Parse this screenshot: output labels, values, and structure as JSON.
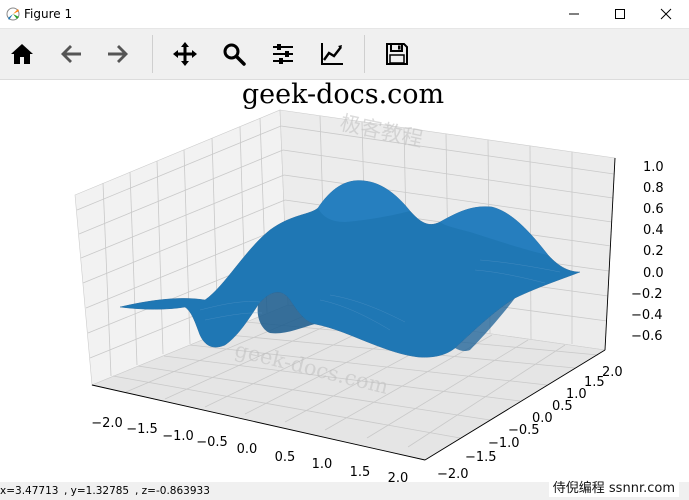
{
  "window": {
    "title": "Figure 1"
  },
  "toolbar": {
    "buttons": [
      {
        "icon": "home-icon"
      },
      {
        "icon": "back-arrow-icon"
      },
      {
        "icon": "forward-arrow-icon"
      },
      {
        "icon": "pan-move-icon"
      },
      {
        "icon": "zoom-magnifier-icon"
      },
      {
        "icon": "configure-subplots-icon"
      },
      {
        "icon": "edit-axes-icon"
      },
      {
        "icon": "save-disk-icon"
      }
    ]
  },
  "figure": {
    "title": "geek-docs.com",
    "watermark_top": "极客教程",
    "watermark_mid": "geek-docs.com",
    "surface_color": "#1f77b4",
    "x_ticks": [
      "−2.0",
      "−1.5",
      "−1.0",
      "−0.5",
      "0.0",
      "0.5",
      "1.0",
      "1.5",
      "2.0"
    ],
    "y_ticks": [
      "−2.0",
      "−1.5",
      "−1.0",
      "−0.5",
      "0.0",
      "0.5",
      "1.0",
      "1.5",
      "2.0"
    ],
    "z_ticks": [
      "1.0",
      "0.8",
      "0.6",
      "0.4",
      "0.2",
      "0.0",
      "−0.2",
      "−0.4",
      "−0.6"
    ]
  },
  "chart_data": {
    "type": "surface",
    "title": "",
    "xlim": [
      -2,
      2
    ],
    "ylim": [
      -2,
      2
    ],
    "zlim": [
      -0.7,
      1.0
    ],
    "grid": true
  },
  "status": {
    "x": "x=3.47713",
    "y": ", y=1.32785",
    "z": ", z=-0.863933"
  },
  "corner_watermark": "侍倪编程 ssnnr.com"
}
